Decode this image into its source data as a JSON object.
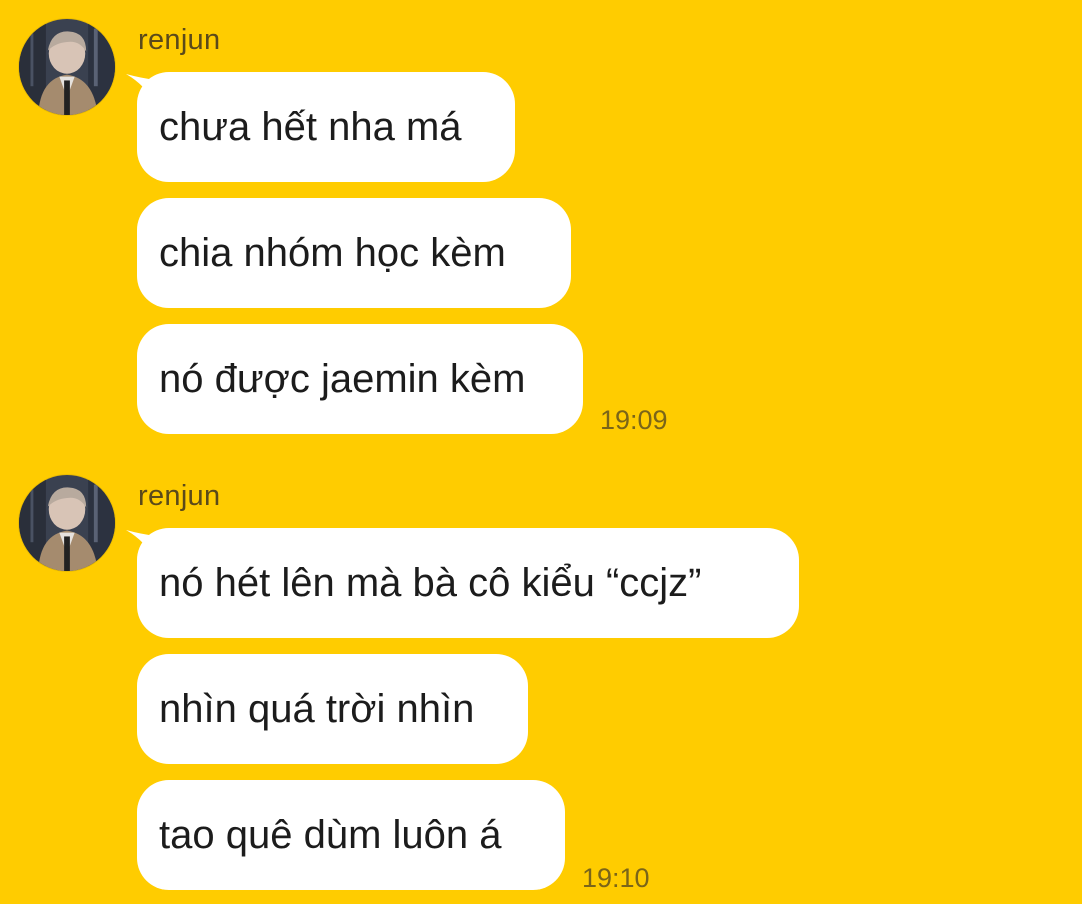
{
  "colors": {
    "background": "#FFCC00",
    "bubble": "#FFFFFF",
    "message_text": "#1C1C1C",
    "meta_text": "#7A6519"
  },
  "groups": [
    {
      "sender": "renjun",
      "avatar_icon": "profile-photo-avatar",
      "messages": [
        "chưa hết nha má",
        "chia nhóm học kèm",
        "nó được jaemin kèm"
      ],
      "time": "19:09"
    },
    {
      "sender": "renjun",
      "avatar_icon": "profile-photo-avatar",
      "messages": [
        "nó hét lên mà bà cô kiểu “ccjz”",
        "nhìn quá trời nhìn",
        "tao quê dùm luôn á"
      ],
      "time": "19:10"
    }
  ]
}
